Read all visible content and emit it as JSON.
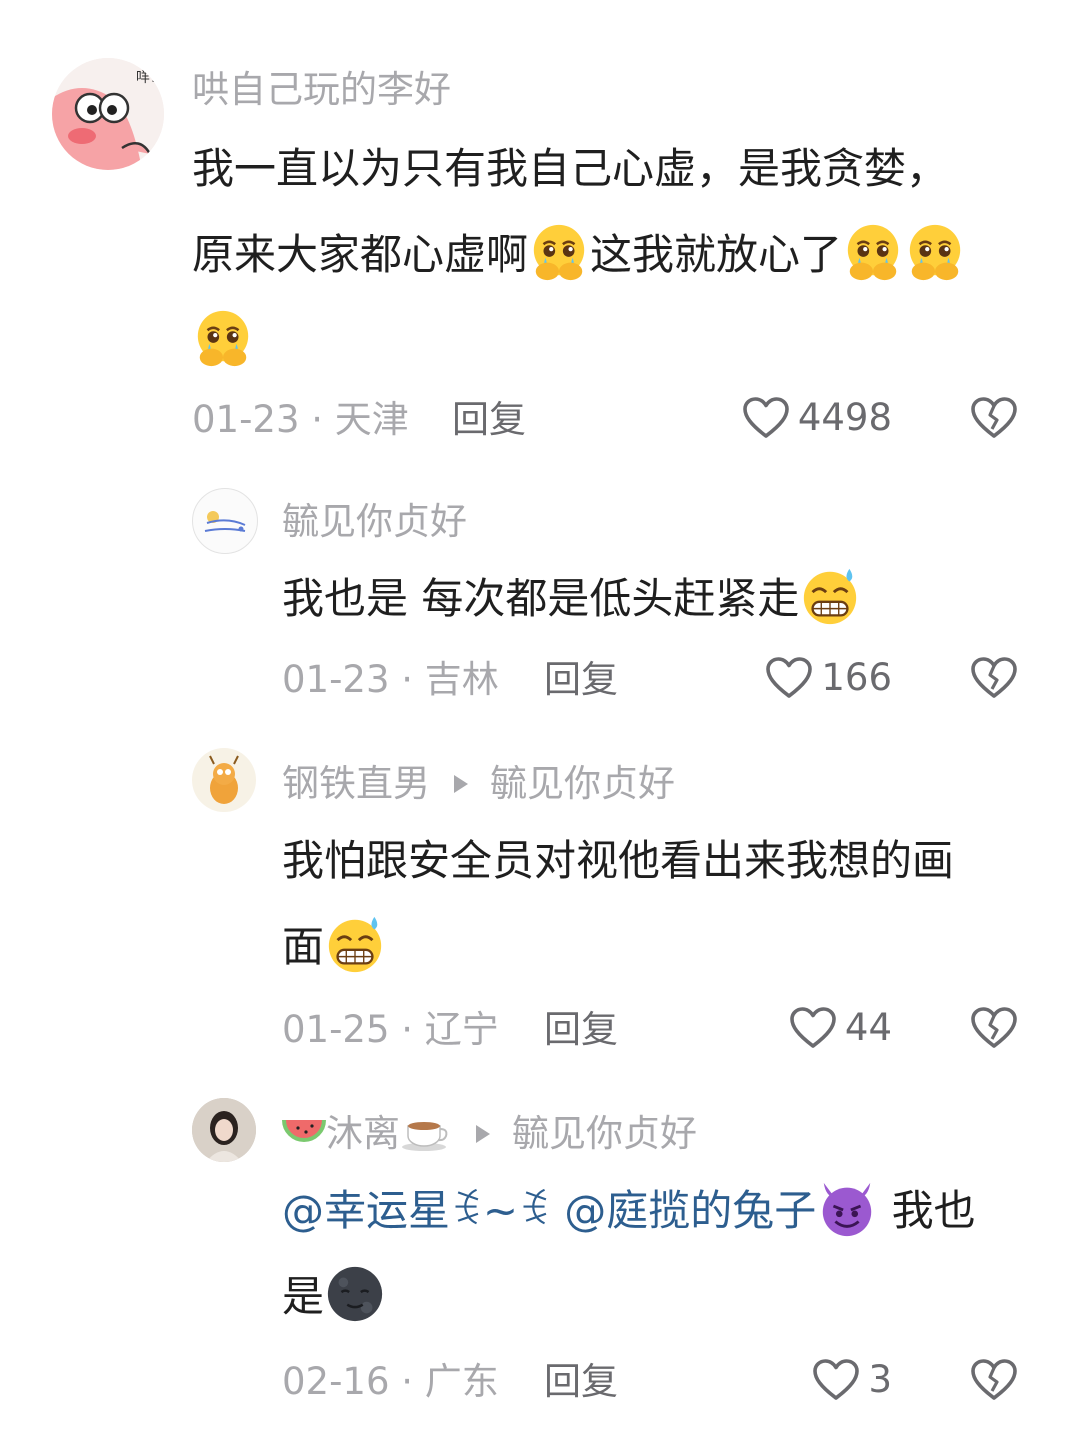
{
  "comments": [
    {
      "user": "哄自己玩的李好",
      "avatar_text": "咩？",
      "text1": "我一直以为只有我自己心虚，是我贪婪，",
      "text2a": "原来大家都心虚啊",
      "text2b": "这我就放心了",
      "date": "01-23 · 天津",
      "reply": "回复",
      "likes": "4498"
    },
    {
      "user": "毓见你贞好",
      "text1": "我也是 每次都是低头赶紧走",
      "date": "01-23 · 吉林",
      "reply": "回复",
      "likes": "166"
    },
    {
      "user": "钢铁直男",
      "reply_to": "毓见你贞好",
      "text1": "我怕跟安全员对视他看出来我想的画",
      "text2": "面",
      "date": "01-25 · 辽宁",
      "reply": "回复",
      "likes": "44"
    },
    {
      "user": "沐离",
      "reply_to": "毓见你贞好",
      "mention1": "@幸运星ꉂ~ꉂ",
      "mention2": "@庭揽的兔子",
      "text1": "我也",
      "text2": "是",
      "date": "02-16 · 广东",
      "reply": "回复",
      "likes": "3"
    }
  ],
  "icons": {
    "like": "heart-outline-icon",
    "dislike": "broken-heart-icon"
  },
  "colors": {
    "name": "#a8a8ac",
    "text": "#1f1f1f",
    "mention": "#2d5e8f",
    "meta": "#a8a8ac"
  }
}
